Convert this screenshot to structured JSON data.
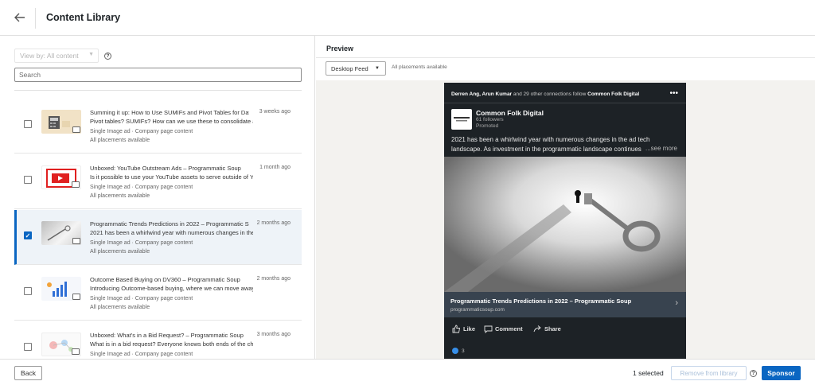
{
  "header": {
    "title": "Content Library",
    "back_icon": "arrow-left-icon"
  },
  "filter": {
    "view_by_label": "View by: All content",
    "help_icon": "question-circle-icon"
  },
  "search": {
    "placeholder": "Search",
    "value": ""
  },
  "items": [
    {
      "title": "Summing it up: How to Use SUMIFs and Pivot Tables for Data Ana...",
      "description": "Pivot tables? SUMIFs? How can we use these to consolidate and ...",
      "type": "Single Image ad · Company page content",
      "placements": "All placements available",
      "ago": "3 weeks ago",
      "checked": false
    },
    {
      "title": "Unboxed: YouTube Outstream Ads – Programmatic Soup",
      "description": "Is it possible to use your YouTube assets to serve outside of YouT...",
      "type": "Single Image ad · Company page content",
      "placements": "All placements available",
      "ago": "1 month ago",
      "checked": false
    },
    {
      "title": "Programmatic Trends Predictions in 2022 – Programmatic Soup",
      "description": "2021 has been a whirlwind year with numerous changes in the a...",
      "type": "Single Image ad · Company page content",
      "placements": "All placements available",
      "ago": "2 months ago",
      "checked": true
    },
    {
      "title": "Outcome Based Buying on DV360 – Programmatic Soup",
      "description": "Introducing Outcome-based buying, where we can move away fr...",
      "type": "Single Image ad · Company page content",
      "placements": "All placements available",
      "ago": "2 months ago",
      "checked": false
    },
    {
      "title": "Unboxed: What’s in a Bid Request? – Programmatic Soup",
      "description": "What is in a bid request? Everyone knows both ends of the chai...",
      "type": "Single Image ad · Company page content",
      "placements": "",
      "ago": "3 months ago",
      "checked": false
    }
  ],
  "preview": {
    "title": "Preview",
    "feed_select": "Desktop Feed",
    "placements_note": "All placements available",
    "post": {
      "connections_prefix": "Derren Ang, Arun Kumar",
      "connections_mid": " and 29 other connections follow ",
      "connections_company": "Common Folk Digital",
      "company": "Common Folk Digital",
      "followers": "61 followers",
      "promoted": "Promoted",
      "body": "2021 has been a whirlwind year with numerous changes in the ad tech landscape. As investment in the programmatic landscape continues",
      "see_more": "...see more",
      "link_title": "Programmatic Trends Predictions in 2022 – Programmatic Soup",
      "link_domain": "programmaticsoup.com",
      "like": "Like",
      "comment": "Comment",
      "share": "Share",
      "reaction_count": "3"
    }
  },
  "footer": {
    "back_label": "Back",
    "selected_text": "1 selected",
    "remove_label": "Remove from library",
    "sponsor_label": "Sponsor"
  },
  "colors": {
    "accent": "#0a66c2",
    "selected_bg": "#eef3f8",
    "post_bg": "#1d2226"
  }
}
